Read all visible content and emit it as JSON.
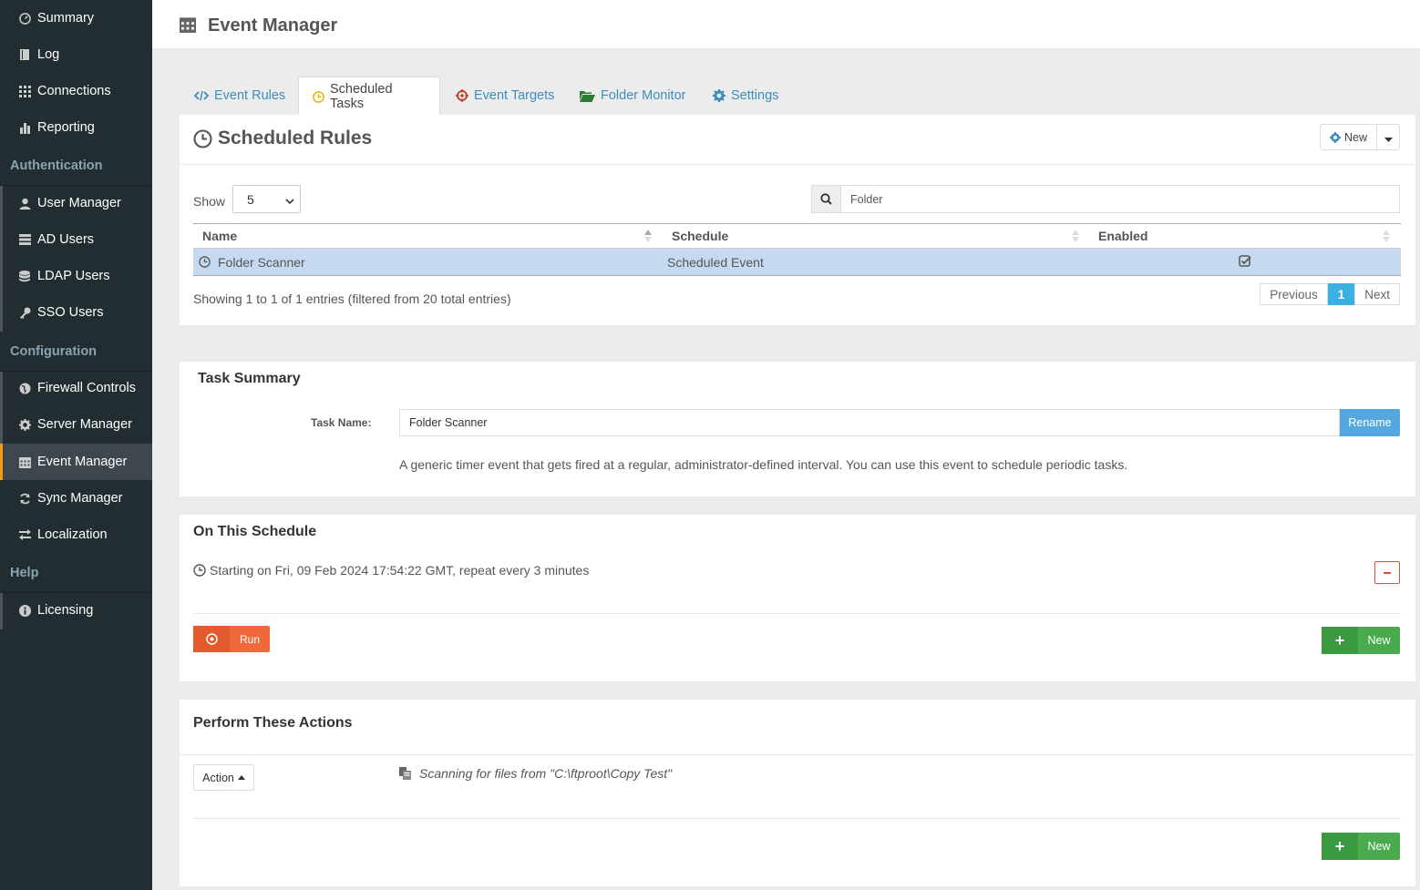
{
  "sidebar": {
    "items": [
      {
        "label": "Summary",
        "icon": "dashboard-icon"
      },
      {
        "label": "Log",
        "icon": "book-icon"
      },
      {
        "label": "Connections",
        "icon": "grid-icon"
      },
      {
        "label": "Reporting",
        "icon": "bar-chart-icon"
      },
      {
        "label": "User Manager",
        "icon": "user-icon"
      },
      {
        "label": "AD Users",
        "icon": "list-icon"
      },
      {
        "label": "LDAP Users",
        "icon": "database-icon"
      },
      {
        "label": "SSO Users",
        "icon": "key-icon"
      },
      {
        "label": "Firewall Controls",
        "icon": "globe-icon"
      },
      {
        "label": "Server Manager",
        "icon": "gear-icon"
      },
      {
        "label": "Event Manager",
        "icon": "calendar-icon"
      },
      {
        "label": "Sync Manager",
        "icon": "refresh-icon"
      },
      {
        "label": "Localization",
        "icon": "exchange-icon"
      },
      {
        "label": "Licensing",
        "icon": "info-icon"
      }
    ],
    "headers": [
      "Authentication",
      "Configuration",
      "Help"
    ],
    "active_accent": "#f39c12"
  },
  "header": {
    "title": "Event Manager"
  },
  "tabs": [
    {
      "label": "Event Rules",
      "icon": "code-icon"
    },
    {
      "label": "Scheduled Tasks",
      "icon": "clock-icon"
    },
    {
      "label": "Event Targets",
      "icon": "crosshair-icon"
    },
    {
      "label": "Folder Monitor",
      "icon": "folder-open-icon"
    },
    {
      "label": "Settings",
      "icon": "gear-icon"
    }
  ],
  "rules": {
    "title": "Scheduled Rules",
    "new_button": "New",
    "show_label": "Show",
    "page_size": "5",
    "search_value": "Folder",
    "columns": [
      "Name",
      "Schedule",
      "Enabled"
    ],
    "rows": [
      {
        "name": "Folder Scanner",
        "schedule": "Scheduled Event",
        "enabled": true
      }
    ],
    "info": "Showing 1 to 1 of 1 entries (filtered from 20 total entries)",
    "pager": {
      "previous": "Previous",
      "current": "1",
      "next": "Next"
    }
  },
  "task_summary": {
    "title": "Task Summary",
    "task_name_label": "Task Name:",
    "task_name_value": "Folder Scanner",
    "rename_button": "Rename",
    "description": "A generic timer event that gets fired at a regular, administrator-defined interval. You can use this event to schedule periodic tasks."
  },
  "schedule": {
    "title": "On This Schedule",
    "entry": "Starting on Fri, 09 Feb 2024 17:54:22 GMT, repeat every 3 minutes",
    "run_button": "Run",
    "new_button": "New"
  },
  "actions": {
    "title": "Perform These Actions",
    "action_button": "Action",
    "entry": "Scanning for files from \"C:\\ftproot\\Copy Test\"",
    "new_button": "New"
  },
  "colors": {
    "sidebar_bg": "#222d32",
    "link": "#3c8dbc",
    "row_highlight": "#c5d9f1",
    "run_orange": "#f0693a",
    "new_green": "#4aab4e",
    "rename_blue": "#55a8df"
  }
}
